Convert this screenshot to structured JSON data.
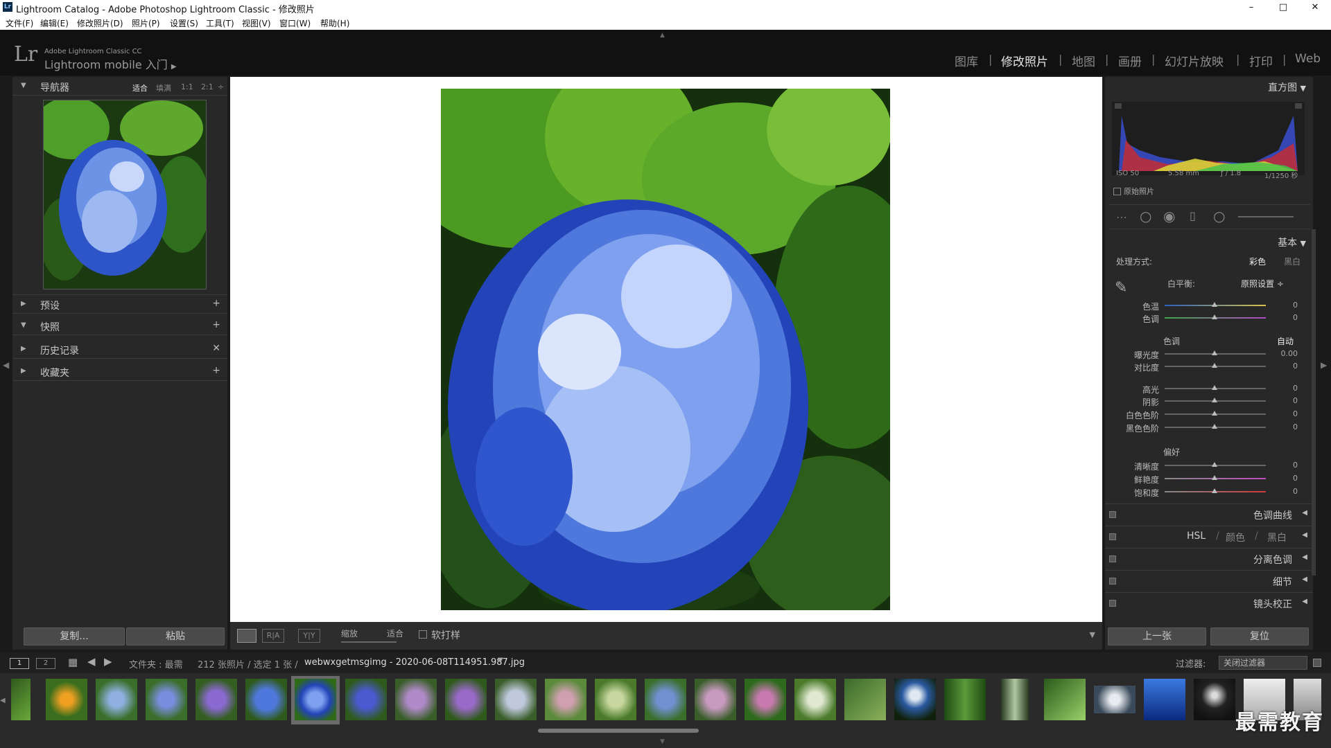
{
  "window": {
    "title": "Lightroom Catalog - Adobe Photoshop Lightroom Classic - 修改照片",
    "icon_text": "Lr",
    "controls": [
      "–",
      "□",
      "✕"
    ]
  },
  "menu": [
    "文件(F)",
    "编辑(E)",
    "修改照片(D)",
    "照片(P)",
    "设置(S)",
    "工具(T)",
    "视图(V)",
    "窗口(W)",
    "帮助(H)"
  ],
  "identity": {
    "logo": "Lr",
    "product": "Adobe Lightroom Classic CC",
    "mobile": "Lightroom mobile 入门",
    "mobile_arrow": "▶"
  },
  "modules": [
    {
      "label": "图库",
      "active": false
    },
    {
      "label": "修改照片",
      "active": true
    },
    {
      "label": "地图",
      "active": false
    },
    {
      "label": "画册",
      "active": false
    },
    {
      "label": "幻灯片放映",
      "active": false
    },
    {
      "label": "打印",
      "active": false
    },
    {
      "label": "Web",
      "active": false
    }
  ],
  "left_panel": {
    "navigator": {
      "title": "导航器",
      "zoom_options": [
        "适合",
        "填满",
        "1:1",
        "2:1"
      ],
      "selected_zoom": "适合"
    },
    "sections": [
      {
        "title": "预设",
        "action": "+",
        "expanded": false
      },
      {
        "title": "快照",
        "action": "+",
        "expanded": true
      },
      {
        "title": "历史记录",
        "action": "✕",
        "expanded": false
      },
      {
        "title": "收藏夹",
        "action": "+",
        "expanded": false
      }
    ],
    "copy_button": "复制...",
    "paste_button": "粘贴"
  },
  "toolbar": {
    "zoom_label": "缩放",
    "fit_label": "适合",
    "soft_proof": "软打样"
  },
  "right_panel": {
    "histogram": {
      "title": "直方图",
      "iso": "ISO 50",
      "focal": "5.58 mm",
      "aperture": "ƒ / 1.8",
      "shutter": "1/1250 秒",
      "original_photo": "原始照片"
    },
    "basic": {
      "title": "基本",
      "treatment_label": "处理方式:",
      "treatment_color": "彩色",
      "treatment_bw": "黑白",
      "wb_label": "白平衡:",
      "wb_value": "原照设置 ÷",
      "wb_sliders": [
        {
          "label": "色温",
          "value": "0"
        },
        {
          "label": "色调",
          "value": "0"
        }
      ],
      "tone_label": "色调",
      "auto_label": "自动",
      "tone_sliders": [
        {
          "label": "曝光度",
          "value": "0.00"
        },
        {
          "label": "对比度",
          "value": "0"
        }
      ],
      "range_sliders": [
        {
          "label": "高光",
          "value": "0"
        },
        {
          "label": "阴影",
          "value": "0"
        },
        {
          "label": "白色色阶",
          "value": "0"
        },
        {
          "label": "黑色色阶",
          "value": "0"
        }
      ],
      "presence_label": "偏好",
      "presence_sliders": [
        {
          "label": "清晰度",
          "value": "0"
        },
        {
          "label": "鲜艳度",
          "value": "0"
        },
        {
          "label": "饱和度",
          "value": "0"
        }
      ]
    },
    "collapsed_panels": [
      "色调曲线",
      "分离色调",
      "细节",
      "镜头校正"
    ],
    "hsl": {
      "a": "HSL",
      "b": "颜色",
      "c": "黑白",
      "slash": "/"
    },
    "prev_button": "上一张",
    "reset_button": "复位"
  },
  "filmbar": {
    "page1": "1",
    "page2": "2",
    "source": "文件夹 : 最需",
    "count": "212 张照片 / 选定 1 张 /",
    "filename": "webwxgetmsgimg - 2020-06-08T114951.987.jpg",
    "filter_label": "过滤器:",
    "filter_value": "关闭过滤器"
  },
  "watermark": "最需教育",
  "colors": {
    "accent": "#e8e8e8",
    "panel": "#282828",
    "bg": "#1a1a1a"
  }
}
